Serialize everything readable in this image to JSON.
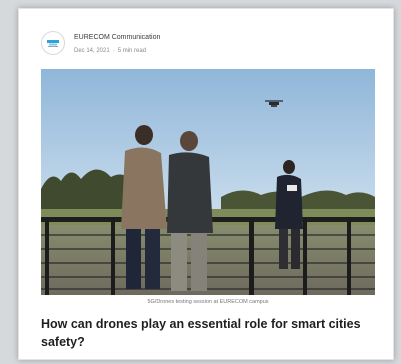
{
  "post": {
    "author": "EURECOM Communication",
    "date": "Dec 14, 2021",
    "separator": "·",
    "read_time": "5 min read",
    "image_caption": "5G/Drones testing session at EURECOM campus",
    "title": "How can drones play an essential role for smart cities safety?"
  },
  "icons": {
    "avatar": "eurecom-logo-icon",
    "drone": "drone-icon"
  },
  "colors": {
    "card_bg": "#ffffff",
    "page_bg": "#d6d9dc",
    "title_text": "#1f1f1f",
    "meta_text": "#8a8a8a",
    "logo_accent": "#2fa3d6"
  }
}
